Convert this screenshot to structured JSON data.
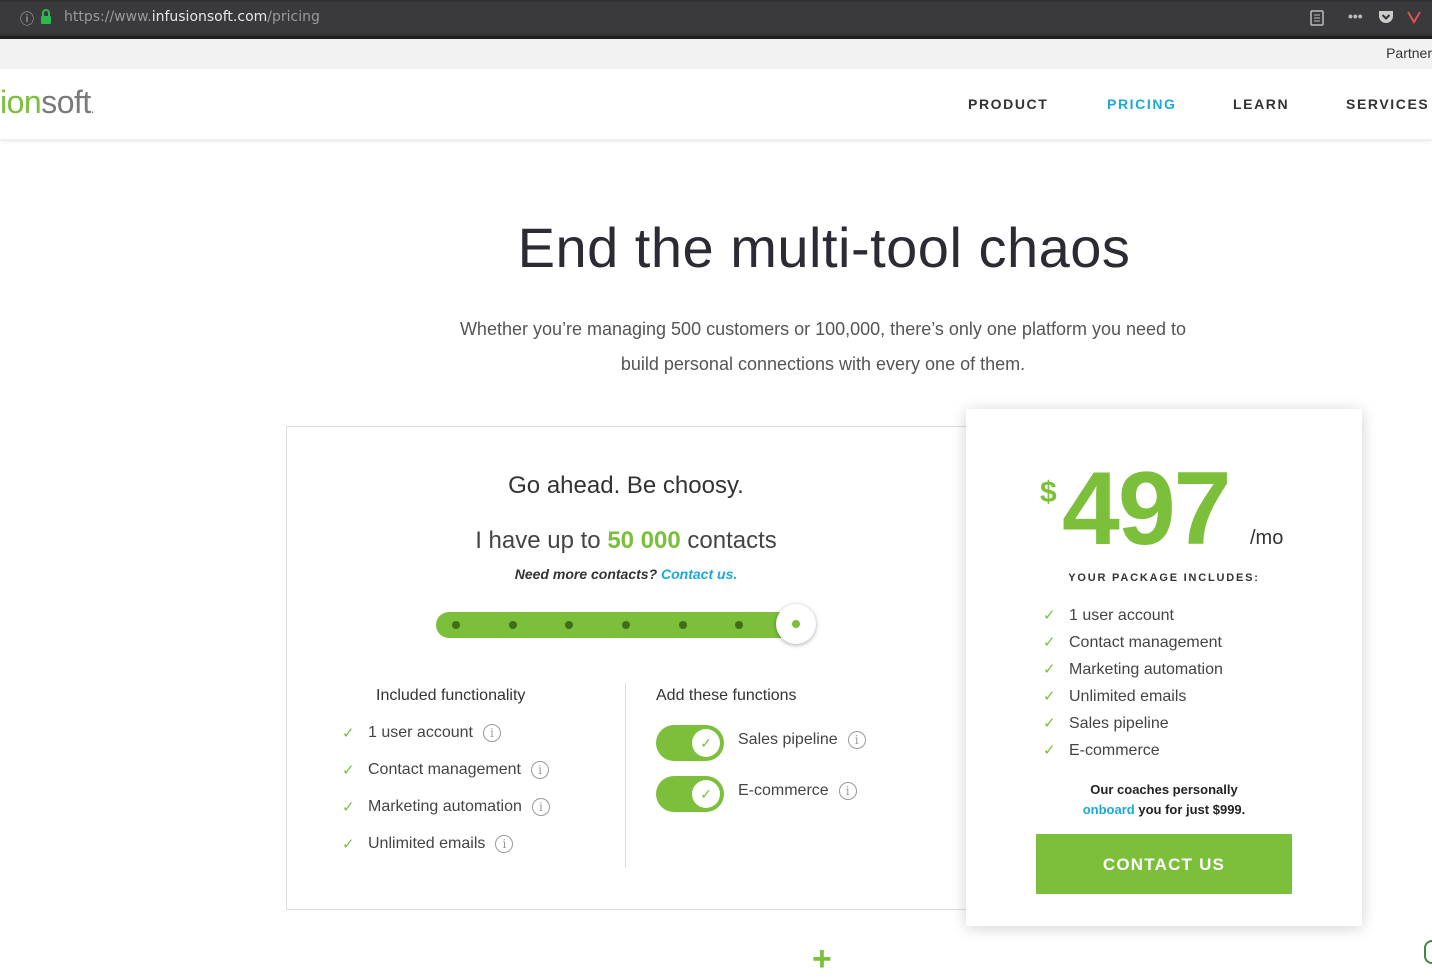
{
  "browser": {
    "url_scheme": "https://www.",
    "url_domain": "infusionsoft.com",
    "url_path": "/pricing"
  },
  "partner_text": "Partner",
  "logo": {
    "green": "ion",
    "gray": "soft",
    "dot": "."
  },
  "nav": {
    "items": [
      "PRODUCT",
      "PRICING",
      "LEARN",
      "SERVICES"
    ],
    "active": "PRICING"
  },
  "hero": {
    "title": "End the multi-tool chaos",
    "subtitle_line1": "Whether you’re managing 500 customers or 100,000, there’s only one platform you need to",
    "subtitle_line2": "build personal connections with every one of them."
  },
  "chooser": {
    "title": "Go ahead. Be choosy.",
    "contacts_prefix": "I have up to",
    "contacts_value": "50 000",
    "contacts_suffix": "contacts",
    "need_more": "Need more contacts?",
    "contact_link": "Contact us.",
    "slider_level": 1.0,
    "included_heading": "Included functionality",
    "included": [
      "1 user account",
      "Contact management",
      "Marketing automation",
      "Unlimited emails"
    ],
    "addons_heading": "Add these functions",
    "addons": [
      {
        "label": "Sales pipeline",
        "enabled": true
      },
      {
        "label": "E-commerce",
        "enabled": true
      }
    ]
  },
  "price_card": {
    "currency": "$",
    "amount": "497",
    "period": "/mo",
    "includes_heading": "YOUR PACKAGE INCLUDES:",
    "includes": [
      "1 user account",
      "Contact management",
      "Marketing automation",
      "Unlimited emails",
      "Sales pipeline",
      "E-commerce"
    ],
    "coach_line1": "Our coaches personally",
    "coach_link": "onboard",
    "coach_line2": "you for just $999.",
    "cta": "CONTACT US"
  },
  "colors": {
    "brand_green": "#7bbf3a",
    "link_blue": "#1ca9d8"
  }
}
